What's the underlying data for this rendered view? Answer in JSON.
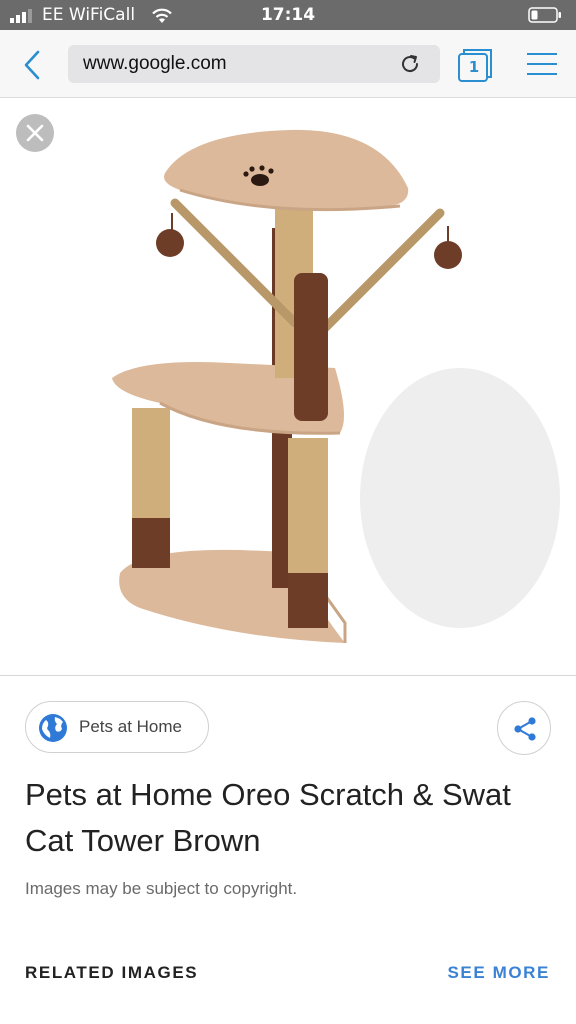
{
  "status_bar": {
    "carrier": "EE WiFiCall",
    "time": "17:14"
  },
  "browser": {
    "url": "www.google.com",
    "tab_count": "1",
    "accent_color": "#2a8ed0"
  },
  "image_viewer": {
    "image_subject": "cat-tower-photo"
  },
  "result": {
    "source": "Pets at Home",
    "title": "Pets at Home Oreo Scratch & Swat Cat Tower Brown",
    "copyright_notice": "Images may be subject to copyright."
  },
  "related": {
    "heading": "RELATED IMAGES",
    "see_more": "SEE MORE",
    "link_color": "#3b82d4"
  }
}
